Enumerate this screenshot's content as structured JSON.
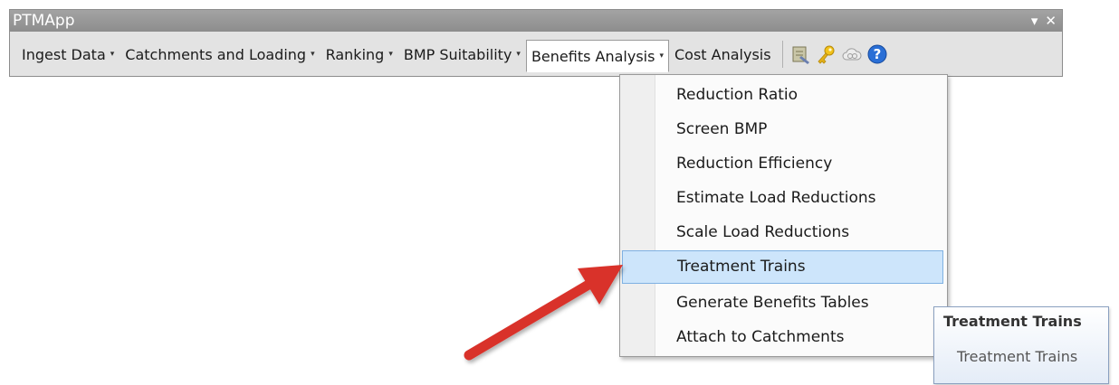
{
  "window": {
    "title": "PTMApp",
    "pin_glyph": "▾",
    "close_glyph": "✕"
  },
  "menubar": {
    "items": [
      {
        "label": "Ingest Data",
        "has_caret": true
      },
      {
        "label": "Catchments and Loading",
        "has_caret": true
      },
      {
        "label": "Ranking",
        "has_caret": true
      },
      {
        "label": "BMP Suitability",
        "has_caret": true
      },
      {
        "label": "Benefits Analysis",
        "has_caret": true,
        "active": true
      },
      {
        "label": "Cost Analysis",
        "has_caret": false
      }
    ],
    "caret_glyph": "▾",
    "icons": [
      "toolbox-icon",
      "key-icon",
      "cloud-icon",
      "help-icon"
    ]
  },
  "dropdown": {
    "items": [
      {
        "label": "Reduction Ratio"
      },
      {
        "label": "Screen BMP"
      },
      {
        "label": "Reduction Efficiency"
      },
      {
        "label": "Estimate Load Reductions"
      },
      {
        "label": "Scale Load Reductions"
      },
      {
        "label": "Treatment Trains",
        "highlighted": true
      },
      {
        "label": "Generate Benefits Tables"
      },
      {
        "label": "Attach to Catchments"
      }
    ]
  },
  "tooltip": {
    "title": "Treatment Trains",
    "body": "Treatment Trains"
  },
  "colors": {
    "highlight": "#cde5fb",
    "arrow": "#d9322c",
    "titlebar": "#999999"
  }
}
